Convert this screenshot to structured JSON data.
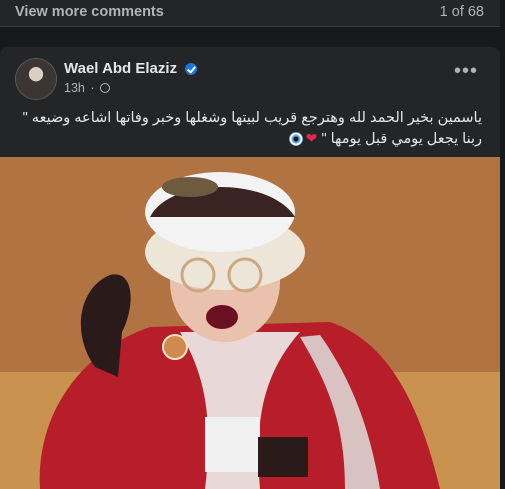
{
  "comments": {
    "view_more_label": "View more comments",
    "count": "1 of 68"
  },
  "post": {
    "author": "Wael Abd Elaziz",
    "time": "13h",
    "separator": "·",
    "text_main": "ياسمين بخير الحمد لله وهترجع قريب لبيتها وشغلها وخبر وفاتها اشاعه وضيعه \" ربنا يجعل يومي قبل يومها \"",
    "icons": [
      "verified-badge",
      "globe",
      "more-horizontal",
      "red-heart",
      "evil-eye"
    ],
    "colors": {
      "background": "#18191a",
      "card": "#242526",
      "verified": "#1b74e4",
      "text_secondary": "#b0b3b8"
    }
  }
}
